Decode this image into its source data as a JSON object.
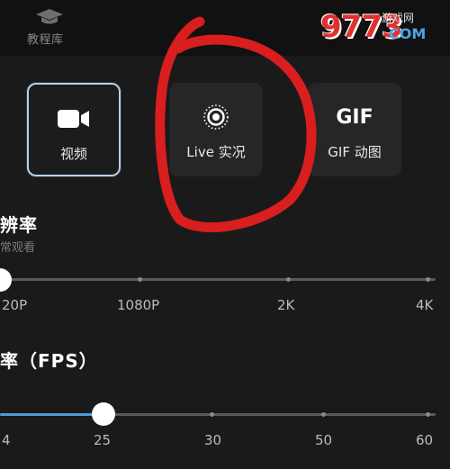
{
  "tutorial": {
    "icon": "graduation-cap-icon",
    "label": "教程库"
  },
  "watermark": {
    "number": "9773",
    "site": "游戏网",
    "com": "COM"
  },
  "modes": [
    {
      "label": "视频",
      "icon": "video-camera-icon",
      "selected": true
    },
    {
      "label": "Live 实况",
      "icon": "live-photo-icon",
      "selected": false
    },
    {
      "label": "GIF 动图",
      "icon": "gif-icon",
      "icon_text": "GIF",
      "selected": false
    }
  ],
  "resolution": {
    "heading": "辨率",
    "subtext": "常观看",
    "options": [
      "20P",
      "1080P",
      "2K",
      "4K"
    ],
    "selected_index": 0
  },
  "fps": {
    "heading": "率（FPS）",
    "options": [
      "4",
      "25",
      "30",
      "50",
      "60"
    ],
    "selected_index": 1
  },
  "colors": {
    "accent": "#4d9ad8",
    "annotation": "#d81e1e",
    "selected_border": "#b9cfe6"
  }
}
